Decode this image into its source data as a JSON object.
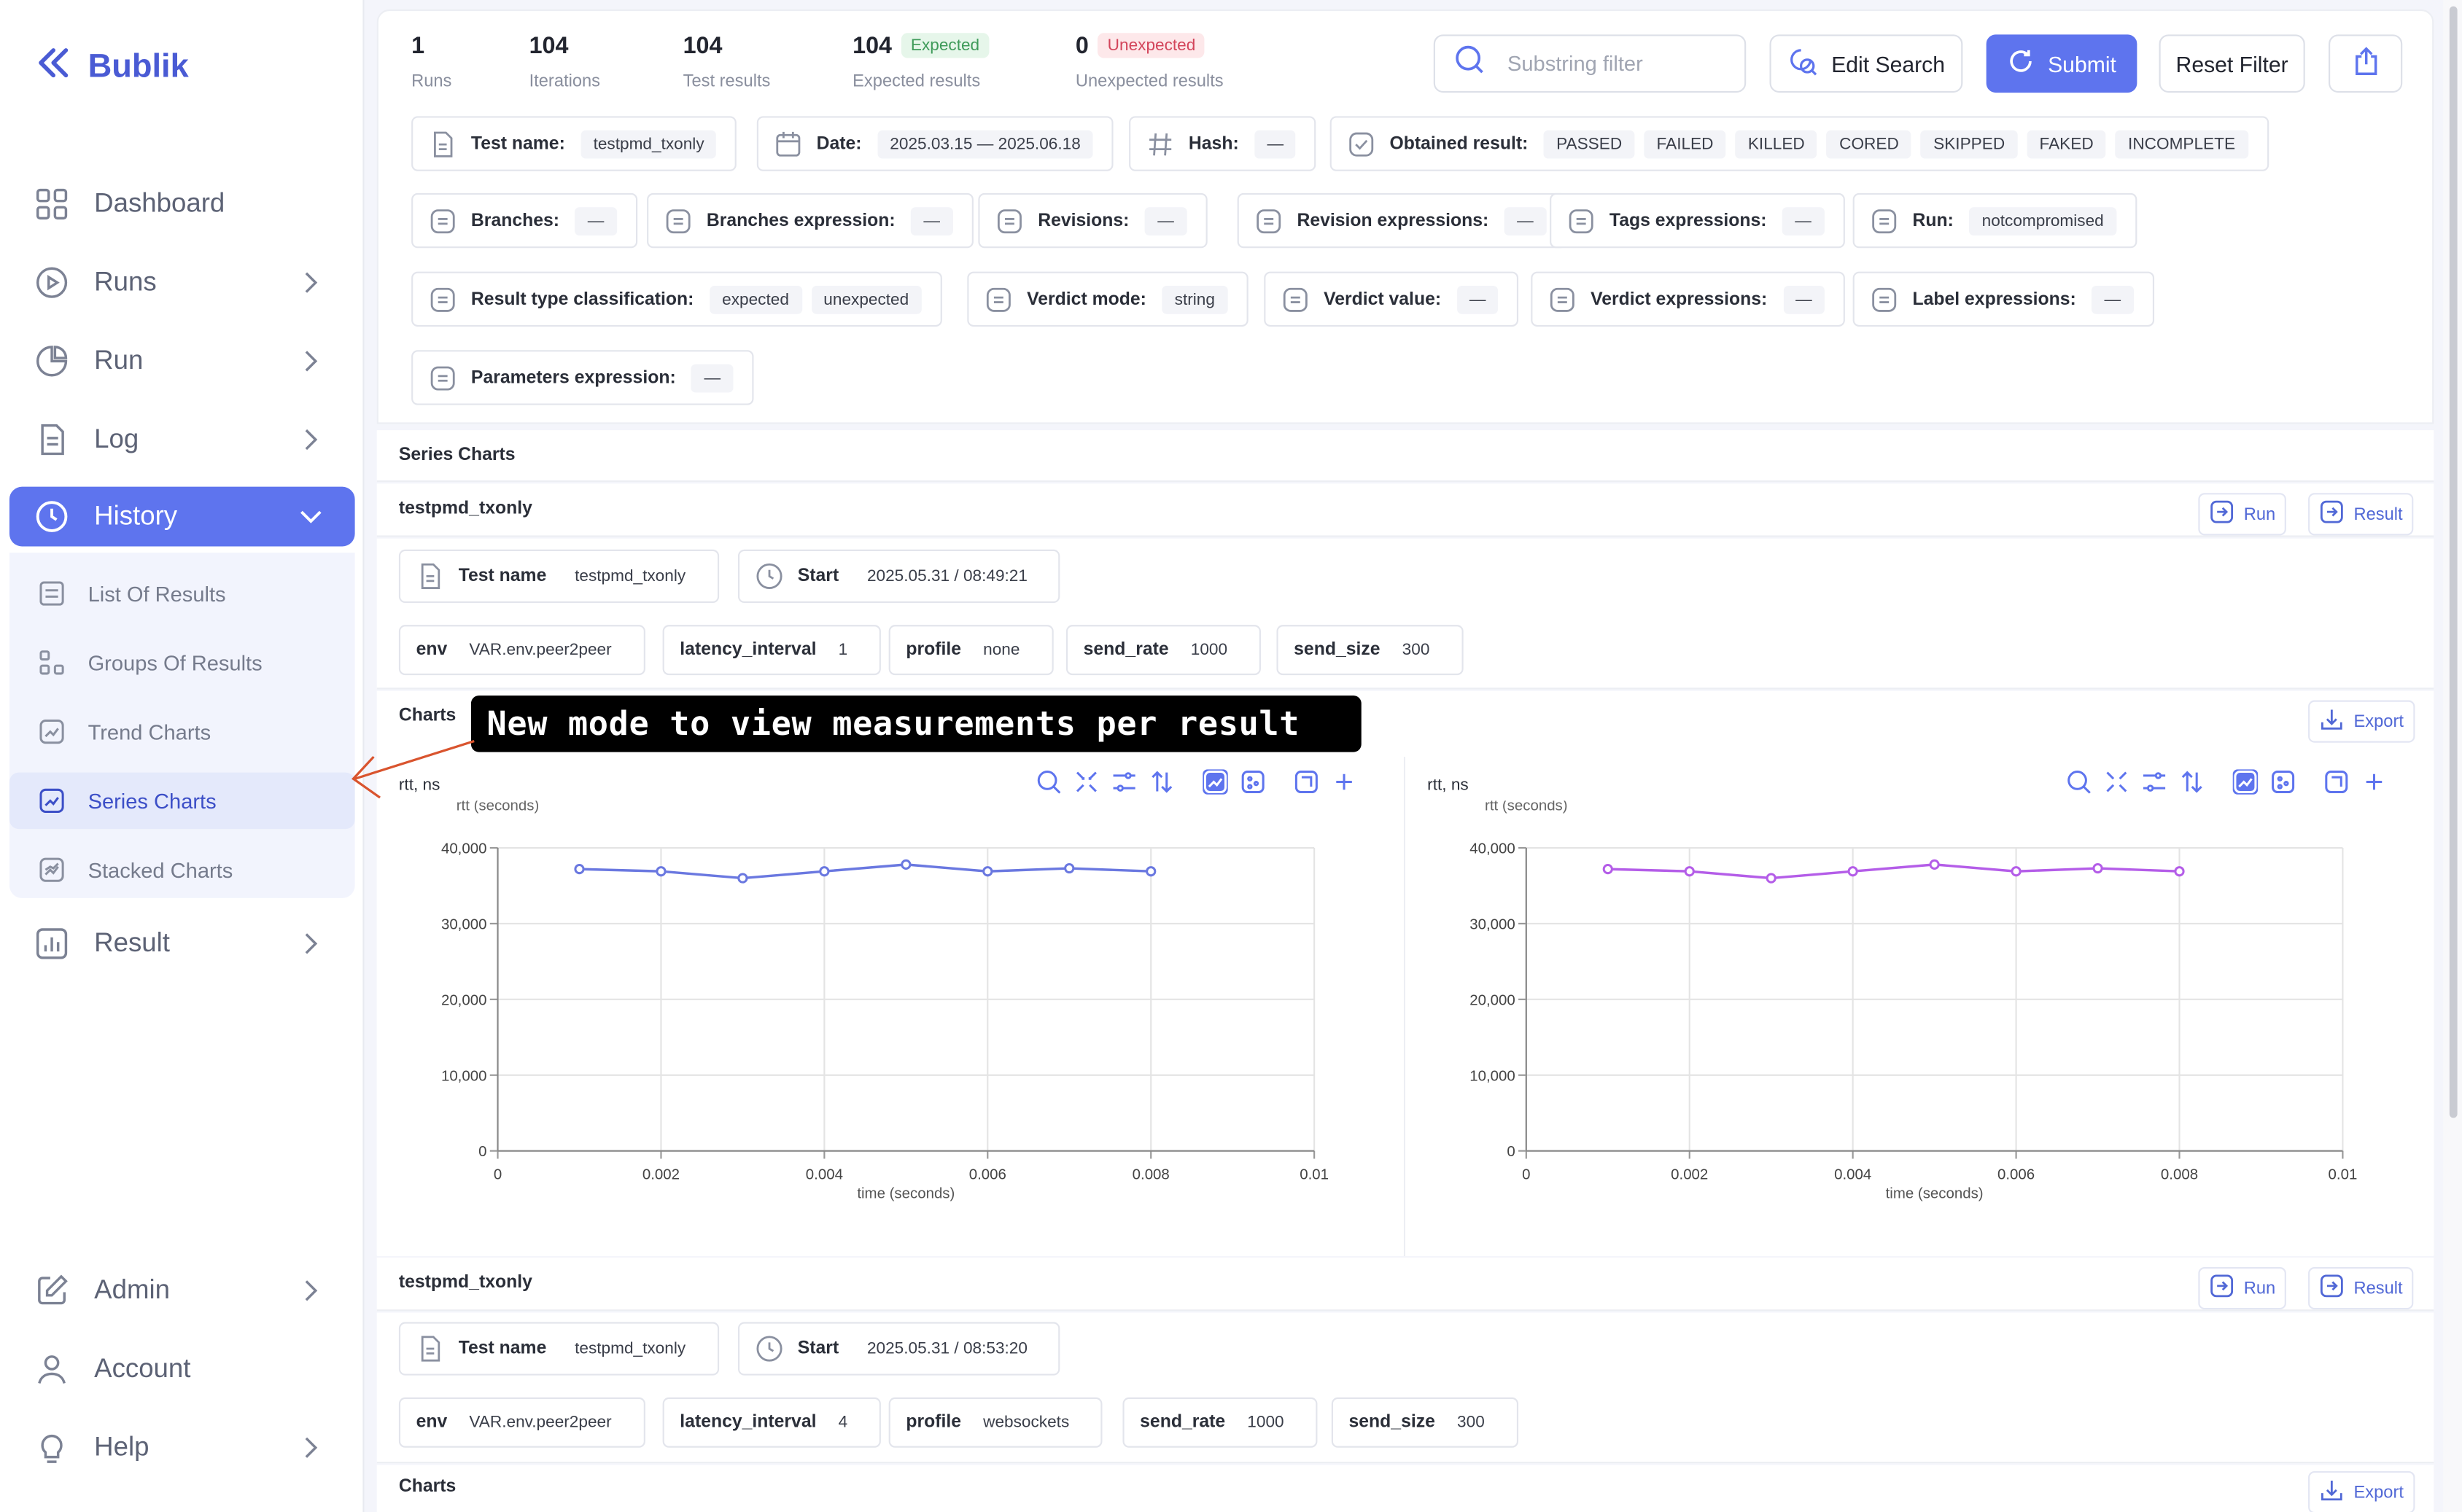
{
  "app": {
    "name": "Bublik"
  },
  "sidebar": {
    "items": [
      {
        "label": "Dashboard",
        "icon": "dashboard-icon"
      },
      {
        "label": "Runs",
        "icon": "runs-icon"
      },
      {
        "label": "Run",
        "icon": "run-icon"
      },
      {
        "label": "Log",
        "icon": "log-icon"
      },
      {
        "label": "History",
        "icon": "history-icon"
      },
      {
        "label": "Result",
        "icon": "result-icon"
      },
      {
        "label": "Admin",
        "icon": "admin-icon"
      },
      {
        "label": "Account",
        "icon": "account-icon"
      },
      {
        "label": "Help",
        "icon": "help-icon"
      }
    ],
    "history_sub": [
      {
        "label": "List Of Results"
      },
      {
        "label": "Groups Of Results"
      },
      {
        "label": "Trend Charts"
      },
      {
        "label": "Series Charts"
      },
      {
        "label": "Stacked Charts"
      }
    ]
  },
  "stats": [
    {
      "value": "1",
      "label": "Runs"
    },
    {
      "value": "104",
      "label": "Iterations"
    },
    {
      "value": "104",
      "label": "Test results"
    },
    {
      "value": "104",
      "label": "Expected results",
      "badge": "Expected"
    },
    {
      "value": "0",
      "label": "Unexpected results",
      "badge": "Unexpected"
    }
  ],
  "toolbar": {
    "search_placeholder": "Substring filter",
    "edit_search": "Edit Search",
    "submit": "Submit",
    "reset_filter": "Reset Filter"
  },
  "filters": {
    "test_name": {
      "label": "Test name:",
      "value": "testpmd_txonly"
    },
    "date": {
      "label": "Date:",
      "value": "2025.03.15 — 2025.06.18"
    },
    "hash": {
      "label": "Hash:",
      "value": "—"
    },
    "obtained": {
      "label": "Obtained result:",
      "values": [
        "PASSED",
        "FAILED",
        "KILLED",
        "CORED",
        "SKIPPED",
        "FAKED",
        "INCOMPLETE"
      ]
    },
    "branches": {
      "label": "Branches:",
      "value": "—"
    },
    "branches_expr": {
      "label": "Branches expression:",
      "value": "—"
    },
    "revisions": {
      "label": "Revisions:",
      "value": "—"
    },
    "revision_expr": {
      "label": "Revision expressions:",
      "value": "—"
    },
    "tags_expr": {
      "label": "Tags expressions:",
      "value": "—"
    },
    "run": {
      "label": "Run:",
      "value": "notcompromised"
    },
    "result_type": {
      "label": "Result type classification:",
      "values": [
        "expected",
        "unexpected"
      ]
    },
    "verdict_mode": {
      "label": "Verdict mode:",
      "value": "string"
    },
    "verdict_value": {
      "label": "Verdict value:",
      "value": "—"
    },
    "verdict_expr": {
      "label": "Verdict expressions:",
      "value": "—"
    },
    "label_expr": {
      "label": "Label expressions:",
      "value": "—"
    },
    "params_expr": {
      "label": "Parameters expression:",
      "value": "—"
    }
  },
  "series_title": "Series Charts",
  "results": [
    {
      "name": "testpmd_txonly",
      "run": "Run",
      "result": "Result",
      "test_name_label": "Test name",
      "test_name": "testpmd_txonly",
      "start_label": "Start",
      "start": "2025.05.31 / 08:49:21",
      "params": [
        {
          "k": "env",
          "v": "VAR.env.peer2peer"
        },
        {
          "k": "latency_interval",
          "v": "1"
        },
        {
          "k": "profile",
          "v": "none"
        },
        {
          "k": "send_rate",
          "v": "1000"
        },
        {
          "k": "send_size",
          "v": "300"
        }
      ],
      "charts_label": "Charts",
      "export": "Export"
    },
    {
      "name": "testpmd_txonly",
      "run": "Run",
      "result": "Result",
      "test_name_label": "Test name",
      "test_name": "testpmd_txonly",
      "start_label": "Start",
      "start": "2025.05.31 / 08:53:20",
      "params": [
        {
          "k": "env",
          "v": "VAR.env.peer2peer"
        },
        {
          "k": "latency_interval",
          "v": "4"
        },
        {
          "k": "profile",
          "v": "websockets"
        },
        {
          "k": "send_rate",
          "v": "1000"
        },
        {
          "k": "send_size",
          "v": "300"
        }
      ],
      "charts_label": "Charts",
      "export": "Export"
    }
  ],
  "annotation": "New mode to view measurements per result",
  "chart_data": [
    {
      "type": "line",
      "title": "rtt, ns",
      "ylabel": "rtt (seconds)",
      "xlabel": "time (seconds)",
      "x": [
        0.001,
        0.002,
        0.003,
        0.004,
        0.005,
        0.006,
        0.007,
        0.008
      ],
      "series": [
        {
          "values": [
            37200,
            36900,
            36000,
            36900,
            37800,
            36900,
            37300,
            36900
          ],
          "color": "#6a78e0"
        }
      ],
      "xlim": [
        0,
        0.01
      ],
      "ylim": [
        0,
        40000
      ],
      "xticks": [
        "0",
        "0.002",
        "0.004",
        "0.006",
        "0.008",
        "0.01"
      ],
      "yticks": [
        "0",
        "10,000",
        "20,000",
        "30,000",
        "40,000"
      ],
      "grid": true
    },
    {
      "type": "line",
      "title": "rtt, ns",
      "ylabel": "rtt (seconds)",
      "xlabel": "time (seconds)",
      "x": [
        0.001,
        0.002,
        0.003,
        0.004,
        0.005,
        0.006,
        0.007,
        0.008
      ],
      "series": [
        {
          "values": [
            37200,
            36900,
            36000,
            36900,
            37800,
            36900,
            37300,
            36900
          ],
          "color": "#b45de8"
        }
      ],
      "xlim": [
        0,
        0.01
      ],
      "ylim": [
        0,
        40000
      ],
      "xticks": [
        "0",
        "0.002",
        "0.004",
        "0.006",
        "0.008",
        "0.01"
      ],
      "yticks": [
        "0",
        "10,000",
        "20,000",
        "30,000",
        "40,000"
      ],
      "grid": true
    }
  ]
}
